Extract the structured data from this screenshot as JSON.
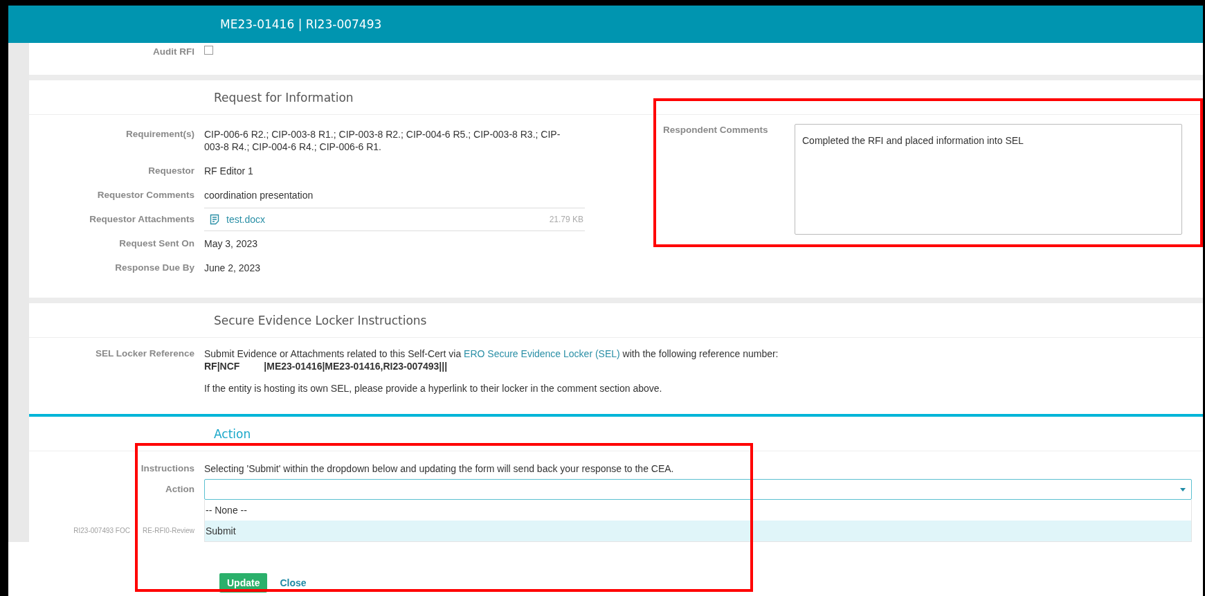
{
  "header": {
    "title": "ME23-01416 | RI23-007493"
  },
  "audit_rfi": {
    "label": "Audit RFI",
    "checked": false
  },
  "request_for_information": {
    "heading": "Request for Information",
    "fields": [
      {
        "kind": "text",
        "label": "Requirement(s)",
        "value": "CIP-006-6 R2.; CIP-003-8 R1.; CIP-003-8 R2.; CIP-004-6 R5.; CIP-003-8 R3.; CIP-003-8 R4.; CIP-004-6 R4.; CIP-006-6 R1."
      },
      {
        "kind": "text",
        "label": "Requestor",
        "value": "RF Editor 1"
      },
      {
        "kind": "text",
        "label": "Requestor Comments",
        "value": "coordination presentation"
      },
      {
        "kind": "attachment",
        "label": "Requestor Attachments",
        "file": "test.docx",
        "size": "21.79 KB"
      },
      {
        "kind": "text",
        "label": "Request Sent On",
        "value": "May 3, 2023"
      },
      {
        "kind": "text",
        "label": "Response Due By",
        "value": "June 2, 2023"
      }
    ],
    "respondent_comments": {
      "label": "Respondent Comments",
      "value": "Completed the RFI and placed information into SEL",
      "highlighted": true
    }
  },
  "sel_instructions": {
    "heading": "Secure Evidence Locker Instructions",
    "label": "SEL Locker Reference",
    "text_before": "Submit Evidence or Attachments related to this Self-Cert via ",
    "link": "ERO Secure Evidence Locker (SEL)",
    "text_after": " with the following reference number:",
    "reference": "RF|NCF         |ME23-01416|ME23-01416,RI23-007493|||",
    "note": "If the entity is hosting its own SEL, please provide a hyperlink to their locker in the comment section above."
  },
  "action": {
    "heading": "Action",
    "highlighted": true,
    "instructions_label": "Instructions",
    "instructions": "Selecting 'Submit' within the dropdown below and updating the form will send back your response to the CEA.",
    "action_label": "Action",
    "dropdown": {
      "expanded": true,
      "options": [
        {
          "label": "-- None --",
          "selected": false
        },
        {
          "label": "Submit",
          "selected": true
        }
      ]
    }
  },
  "footer_note": [
    "RI23-007493 FOC",
    "RE-RFI0-Review"
  ],
  "buttons": [
    {
      "label": "Update",
      "kind": "primary"
    },
    {
      "label": "Close",
      "kind": "link"
    }
  ]
}
